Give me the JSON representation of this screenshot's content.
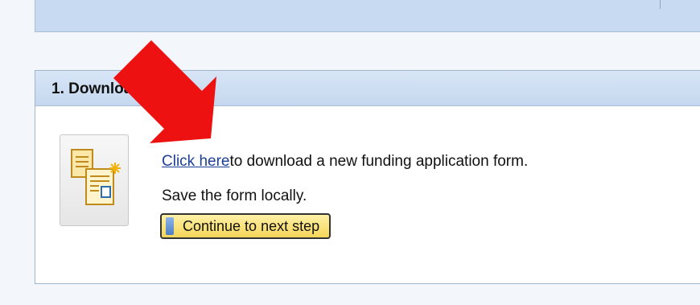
{
  "section": {
    "title": "1. Download form"
  },
  "download": {
    "link_text": "Click here",
    "rest_text": "to download a new funding application form.",
    "save_text": "Save the form locally."
  },
  "actions": {
    "continue_label": "Continue to next step"
  },
  "colors": {
    "link": "#1c3f96",
    "header_blue": "#c6d8ef",
    "button_yellow": "#f5d65a",
    "arrow_red": "#ee1111"
  },
  "icons": {
    "document": "document-new-icon",
    "annotation": "red-arrow-annotation"
  }
}
